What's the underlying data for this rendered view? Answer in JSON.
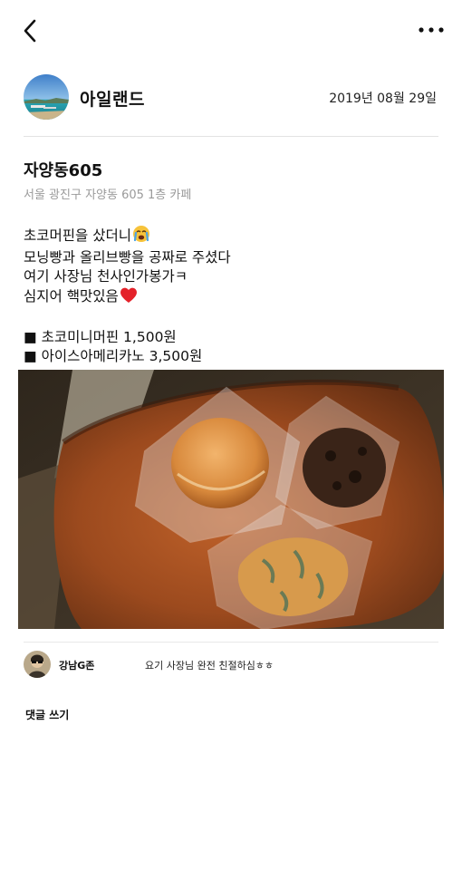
{
  "header": {
    "back_icon": "chevron-left-icon",
    "more_icon": "more-horizontal-icon"
  },
  "post": {
    "author": "아일랜드",
    "date": "2019년 08월 29일",
    "place_name": "자양동605",
    "place_address": "서울 광진구 자양동 605 1층 카페",
    "body_lines": [
      "초코머핀을 샀더니",
      "모닝빵과 올리브빵을 공짜로 주셨다",
      "여기 사장님 천사인가봉가ㅋ",
      "심지어 핵맛있음",
      "■ 초코미니머핀 1,500원",
      "■ 아이스아메리카노 3,500원"
    ],
    "emoji_crying": "crying-face-emoji",
    "emoji_heart": "red-heart-emoji",
    "photo": "photo-of-bagged-bread-and-muffins-on-leather-tray"
  },
  "comments": [
    {
      "user": "강남G존",
      "text": "요기 사장님 완전 친절하심ㅎㅎ"
    }
  ],
  "write_comment_label": "댓글 쓰기",
  "colors": {
    "divider": "#e3e3e3",
    "address_gray": "#9a9a9a",
    "leather": "#9c4a1e"
  }
}
